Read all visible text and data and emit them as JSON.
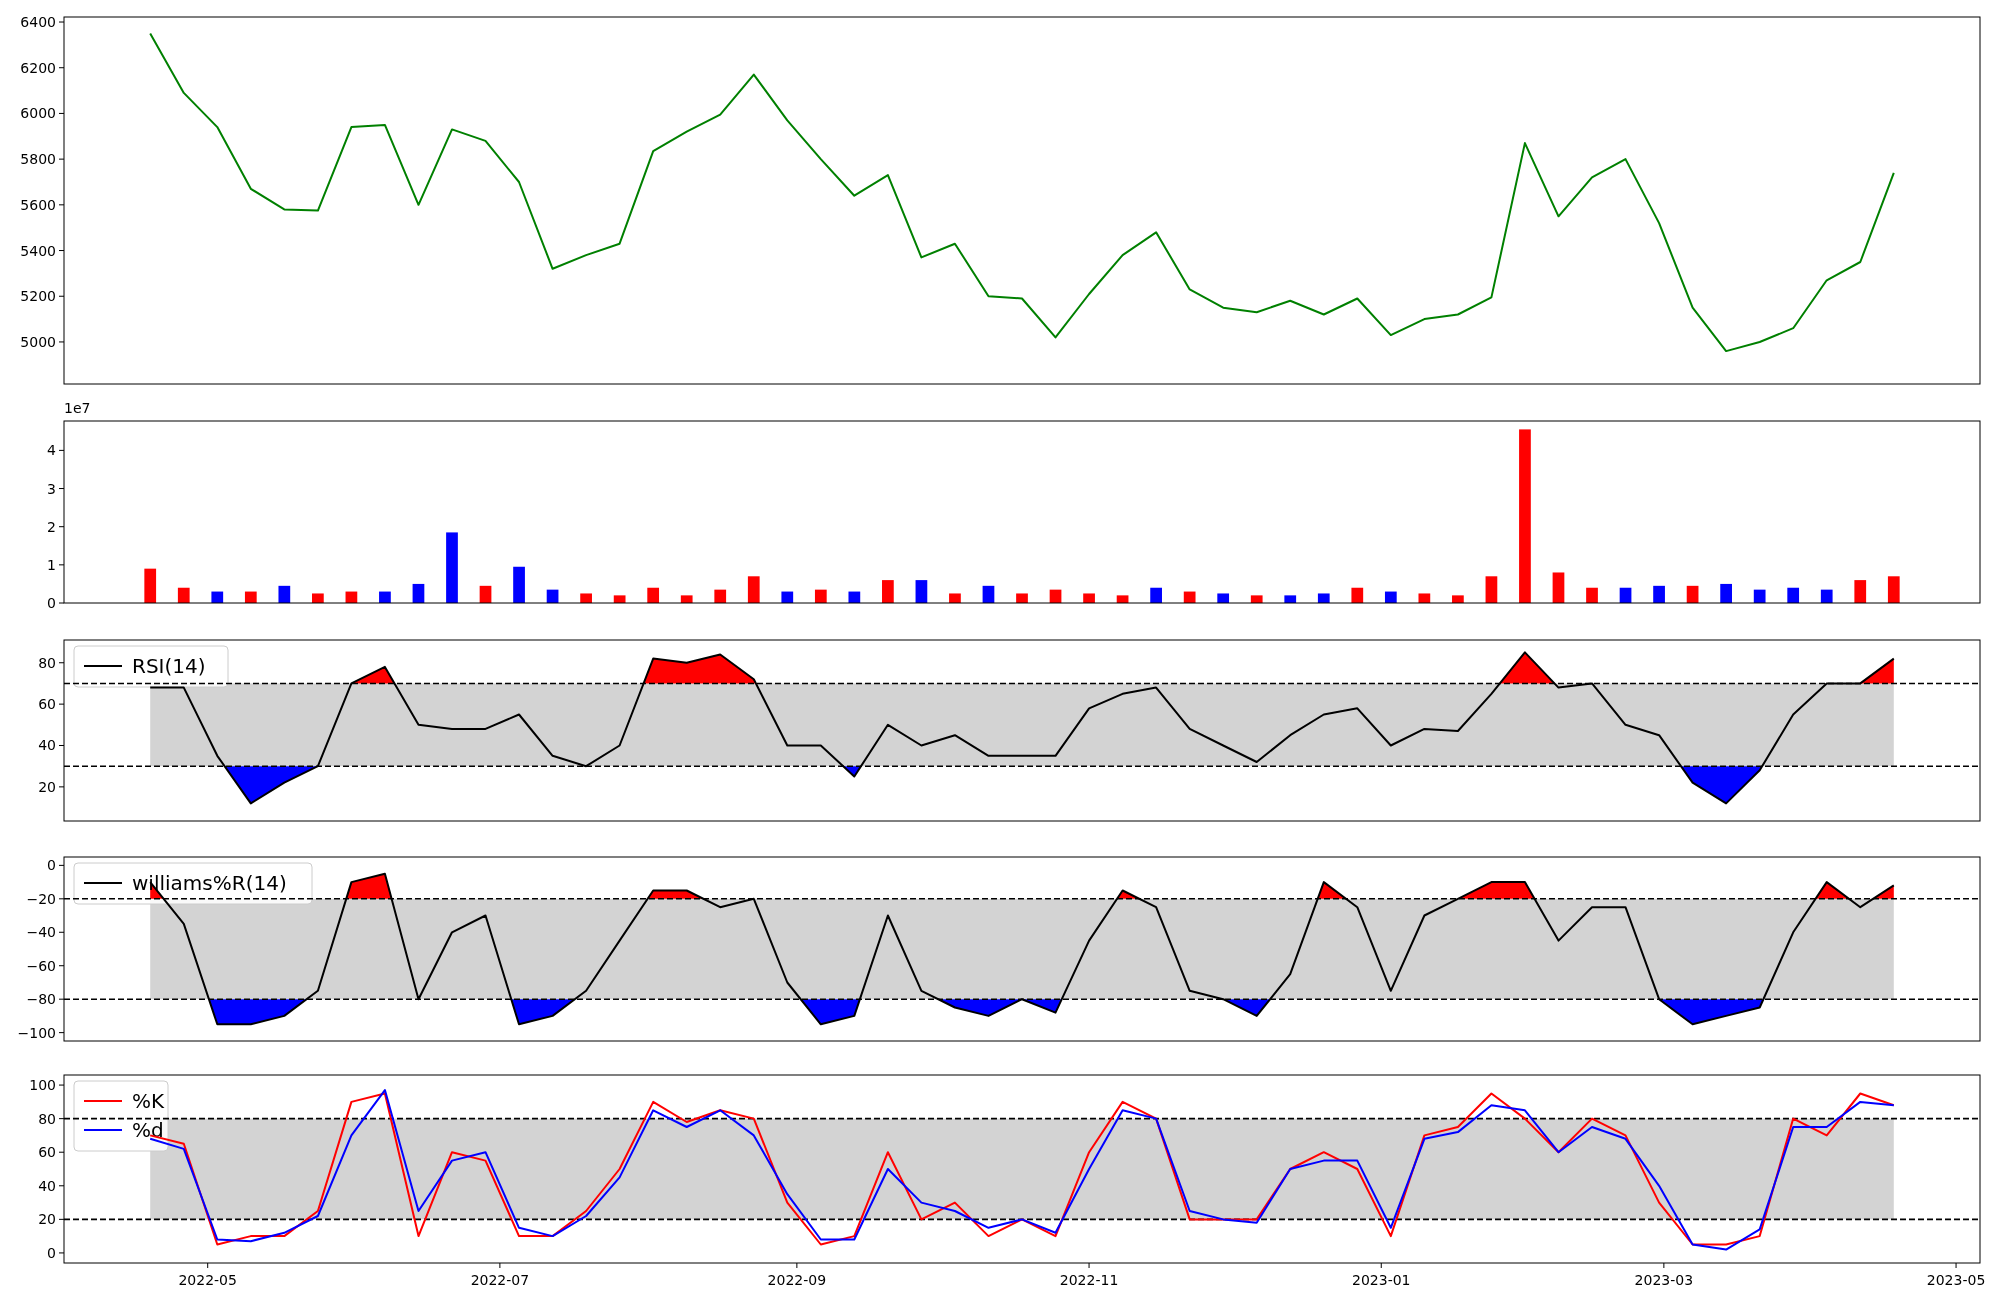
{
  "panels": [
    {
      "chart_data": {
        "type": "line",
        "x": [
          "2022-04-19",
          "2022-04-26",
          "2022-05-03",
          "2022-05-10",
          "2022-05-17",
          "2022-05-24",
          "2022-05-31",
          "2022-06-07",
          "2022-06-14",
          "2022-06-21",
          "2022-06-28",
          "2022-07-05",
          "2022-07-12",
          "2022-07-19",
          "2022-07-26",
          "2022-08-02",
          "2022-08-09",
          "2022-08-16",
          "2022-08-23",
          "2022-08-30",
          "2022-09-06",
          "2022-09-13",
          "2022-09-20",
          "2022-09-27",
          "2022-10-04",
          "2022-10-11",
          "2022-10-18",
          "2022-10-25",
          "2022-11-01",
          "2022-11-08",
          "2022-11-15",
          "2022-11-22",
          "2022-11-29",
          "2022-12-06",
          "2022-12-13",
          "2022-12-20",
          "2022-12-27",
          "2023-01-03",
          "2023-01-10",
          "2023-01-17",
          "2023-01-24",
          "2023-01-31",
          "2023-02-07",
          "2023-02-14",
          "2023-02-21",
          "2023-02-28",
          "2023-03-07",
          "2023-03-14",
          "2023-03-21",
          "2023-03-28",
          "2023-04-04",
          "2023-04-11",
          "2023-04-18"
        ],
        "series": [
          {
            "color": "#008000",
            "values": [
              6350,
              6090,
              5940,
              5670,
              5580,
              5575,
              5940,
              5950,
              5600,
              5930,
              5880,
              5700,
              5320,
              5380,
              5430,
              5835,
              5920,
              5995,
              6170,
              5970,
              5800,
              5640,
              5730,
              5370,
              5430,
              5200,
              5190,
              5020,
              5210,
              5380,
              5480,
              5230,
              5150,
              5130,
              5180,
              5120,
              5190,
              5030,
              5100,
              5120,
              5195,
              5870,
              5550,
              5720,
              5800,
              5520,
              5150,
              4960,
              5000,
              5060,
              5270,
              5350,
              5740
            ]
          }
        ],
        "xlim": [
          "2022-04-01",
          "2023-05-06"
        ],
        "ylim": [
          4816,
          6422
        ],
        "yticks": [
          5000,
          5200,
          5400,
          5600,
          5800,
          6000,
          6200,
          6400
        ]
      }
    },
    {
      "axis_multiplier": "1e7",
      "chart_data": {
        "type": "bar",
        "x": [
          "2022-04-19",
          "2022-04-26",
          "2022-05-03",
          "2022-05-10",
          "2022-05-17",
          "2022-05-24",
          "2022-05-31",
          "2022-06-07",
          "2022-06-14",
          "2022-06-21",
          "2022-06-28",
          "2022-07-05",
          "2022-07-12",
          "2022-07-19",
          "2022-07-26",
          "2022-08-02",
          "2022-08-09",
          "2022-08-16",
          "2022-08-23",
          "2022-08-30",
          "2022-09-06",
          "2022-09-13",
          "2022-09-20",
          "2022-09-27",
          "2022-10-04",
          "2022-10-11",
          "2022-10-18",
          "2022-10-25",
          "2022-11-01",
          "2022-11-08",
          "2022-11-15",
          "2022-11-22",
          "2022-11-29",
          "2022-12-06",
          "2022-12-13",
          "2022-12-20",
          "2022-12-27",
          "2023-01-03",
          "2023-01-10",
          "2023-01-17",
          "2023-01-24",
          "2023-01-31",
          "2023-02-07",
          "2023-02-14",
          "2023-02-21",
          "2023-02-28",
          "2023-03-07",
          "2023-03-14",
          "2023-03-21",
          "2023-03-28",
          "2023-04-04",
          "2023-04-11",
          "2023-04-18"
        ],
        "series": [
          {
            "color": "#ff0000",
            "values": [
              0.9,
              0.4,
              null,
              0.3,
              null,
              0.25,
              0.3,
              null,
              null,
              null,
              0.45,
              null,
              null,
              0.25,
              0.2,
              0.4,
              0.2,
              0.35,
              0.7,
              null,
              0.35,
              null,
              0.6,
              null,
              0.25,
              null,
              0.25,
              0.35,
              0.25,
              0.2,
              null,
              0.3,
              null,
              0.2,
              null,
              null,
              0.4,
              null,
              0.25,
              0.2,
              0.7,
              4.55,
              0.8,
              0.4,
              null,
              null,
              0.45,
              null,
              null,
              null,
              null,
              0.6,
              0.7
            ]
          },
          {
            "color": "#0000ff",
            "values": [
              null,
              null,
              0.3,
              null,
              0.45,
              null,
              null,
              0.3,
              0.5,
              1.85,
              null,
              0.95,
              0.35,
              null,
              null,
              null,
              null,
              null,
              null,
              0.3,
              null,
              0.3,
              null,
              0.6,
              null,
              0.45,
              null,
              null,
              null,
              null,
              0.4,
              null,
              0.25,
              null,
              0.2,
              0.25,
              null,
              0.3,
              null,
              null,
              null,
              null,
              null,
              null,
              0.4,
              0.45,
              null,
              0.5,
              0.35,
              0.4,
              0.35,
              null,
              null
            ]
          }
        ],
        "xlim": [
          "2022-04-01",
          "2023-05-06"
        ],
        "ylim": [
          0,
          4.77
        ],
        "yticks": [
          0,
          1,
          2,
          3,
          4
        ]
      }
    },
    {
      "chart_data": {
        "type": "line",
        "x": [
          "2022-04-19",
          "2022-04-26",
          "2022-05-03",
          "2022-05-10",
          "2022-05-17",
          "2022-05-24",
          "2022-05-31",
          "2022-06-07",
          "2022-06-14",
          "2022-06-21",
          "2022-06-28",
          "2022-07-05",
          "2022-07-12",
          "2022-07-19",
          "2022-07-26",
          "2022-08-02",
          "2022-08-09",
          "2022-08-16",
          "2022-08-23",
          "2022-08-30",
          "2022-09-06",
          "2022-09-13",
          "2022-09-20",
          "2022-09-27",
          "2022-10-04",
          "2022-10-11",
          "2022-10-18",
          "2022-10-25",
          "2022-11-01",
          "2022-11-08",
          "2022-11-15",
          "2022-11-22",
          "2022-11-29",
          "2022-12-06",
          "2022-12-13",
          "2022-12-20",
          "2022-12-27",
          "2023-01-03",
          "2023-01-10",
          "2023-01-17",
          "2023-01-24",
          "2023-01-31",
          "2023-02-07",
          "2023-02-14",
          "2023-02-21",
          "2023-02-28",
          "2023-03-07",
          "2023-03-14",
          "2023-03-21",
          "2023-03-28",
          "2023-04-04",
          "2023-04-11",
          "2023-04-18"
        ],
        "series": [
          {
            "name": "RSI(14)",
            "color": "#000000",
            "values": [
              68,
              68,
              35,
              12,
              22,
              30,
              70,
              78,
              50,
              48,
              48,
              55,
              35,
              30,
              40,
              82,
              80,
              84,
              72,
              40,
              40,
              25,
              50,
              40,
              45,
              35,
              35,
              35,
              58,
              65,
              68,
              48,
              40,
              32,
              45,
              55,
              58,
              40,
              48,
              47,
              65,
              85,
              68,
              70,
              50,
              45,
              22,
              12,
              28,
              55,
              70,
              70,
              82
            ]
          }
        ],
        "xlim": [
          "2022-04-01",
          "2023-05-06"
        ],
        "ylim": [
          3.5,
          91
        ],
        "yticks": [
          20,
          40,
          60,
          80
        ],
        "legend": "upper left",
        "bands": [
          {
            "axis": "y",
            "from": 30,
            "to": 70,
            "color": "#d3d3d3"
          }
        ],
        "ref_lines": [
          {
            "axis": "y",
            "value": 70
          },
          {
            "axis": "y",
            "value": 30
          }
        ]
      },
      "fills": [
        {
          "color": "#ff0000"
        },
        {
          "color": "#0000ff"
        }
      ]
    },
    {
      "chart_data": {
        "type": "line",
        "x": [
          "2022-04-19",
          "2022-04-26",
          "2022-05-03",
          "2022-05-10",
          "2022-05-17",
          "2022-05-24",
          "2022-05-31",
          "2022-06-07",
          "2022-06-14",
          "2022-06-21",
          "2022-06-28",
          "2022-07-05",
          "2022-07-12",
          "2022-07-19",
          "2022-07-26",
          "2022-08-02",
          "2022-08-09",
          "2022-08-16",
          "2022-08-23",
          "2022-08-30",
          "2022-09-06",
          "2022-09-13",
          "2022-09-20",
          "2022-09-27",
          "2022-10-04",
          "2022-10-11",
          "2022-10-18",
          "2022-10-25",
          "2022-11-01",
          "2022-11-08",
          "2022-11-15",
          "2022-11-22",
          "2022-11-29",
          "2022-12-06",
          "2022-12-13",
          "2022-12-20",
          "2022-12-27",
          "2023-01-03",
          "2023-01-10",
          "2023-01-17",
          "2023-01-24",
          "2023-01-31",
          "2023-02-07",
          "2023-02-14",
          "2023-02-21",
          "2023-02-28",
          "2023-03-07",
          "2023-03-14",
          "2023-03-21",
          "2023-03-28",
          "2023-04-04",
          "2023-04-11",
          "2023-04-18"
        ],
        "series": [
          {
            "name": "williams%R(14)",
            "color": "#000000",
            "values": [
              -10,
              -35,
              -95,
              -95,
              -90,
              -75,
              -10,
              -5,
              -80,
              -40,
              -30,
              -95,
              -90,
              -75,
              -45,
              -15,
              -15,
              -25,
              -20,
              -70,
              -95,
              -90,
              -30,
              -75,
              -85,
              -90,
              -80,
              -88,
              -45,
              -15,
              -25,
              -75,
              -80,
              -90,
              -65,
              -10,
              -25,
              -75,
              -30,
              -20,
              -10,
              -10,
              -45,
              -25,
              -25,
              -80,
              -95,
              -90,
              -85,
              -40,
              -10,
              -25,
              -12
            ]
          }
        ],
        "xlim": [
          "2022-04-01",
          "2023-05-06"
        ],
        "ylim": [
          -105,
          5
        ],
        "yticks": [
          {
            "value": 0,
            "label": "0"
          },
          {
            "value": -20,
            "label": "−20"
          },
          {
            "value": -40,
            "label": "−40"
          },
          {
            "value": -60,
            "label": "−60"
          },
          {
            "value": -80,
            "label": "−80"
          },
          {
            "value": -100,
            "label": "−100"
          }
        ],
        "legend": "upper left",
        "bands": [
          {
            "axis": "y",
            "from": -80,
            "to": -20,
            "color": "#d3d3d3"
          }
        ],
        "ref_lines": [
          {
            "axis": "y",
            "value": -20
          },
          {
            "axis": "y",
            "value": -80
          }
        ]
      },
      "fills": [
        {
          "color": "#ff0000"
        },
        {
          "color": "#0000ff"
        }
      ]
    },
    {
      "chart_data": {
        "type": "line",
        "x": [
          "2022-04-19",
          "2022-04-26",
          "2022-05-03",
          "2022-05-10",
          "2022-05-17",
          "2022-05-24",
          "2022-05-31",
          "2022-06-07",
          "2022-06-14",
          "2022-06-21",
          "2022-06-28",
          "2022-07-05",
          "2022-07-12",
          "2022-07-19",
          "2022-07-26",
          "2022-08-02",
          "2022-08-09",
          "2022-08-16",
          "2022-08-23",
          "2022-08-30",
          "2022-09-06",
          "2022-09-13",
          "2022-09-20",
          "2022-09-27",
          "2022-10-04",
          "2022-10-11",
          "2022-10-18",
          "2022-10-25",
          "2022-11-01",
          "2022-11-08",
          "2022-11-15",
          "2022-11-22",
          "2022-11-29",
          "2022-12-06",
          "2022-12-13",
          "2022-12-20",
          "2022-12-27",
          "2023-01-03",
          "2023-01-10",
          "2023-01-17",
          "2023-01-24",
          "2023-01-31",
          "2023-02-07",
          "2023-02-14",
          "2023-02-21",
          "2023-02-28",
          "2023-03-07",
          "2023-03-14",
          "2023-03-21",
          "2023-03-28",
          "2023-04-04",
          "2023-04-11",
          "2023-04-18"
        ],
        "series": [
          {
            "name": "%K",
            "color": "#ff0000",
            "values": [
              70,
              65,
              5,
              10,
              10,
              25,
              90,
              95,
              10,
              60,
              55,
              10,
              10,
              25,
              50,
              90,
              78,
              85,
              80,
              30,
              5,
              10,
              60,
              20,
              30,
              10,
              20,
              10,
              60,
              90,
              80,
              20,
              20,
              20,
              50,
              60,
              50,
              10,
              70,
              75,
              95,
              80,
              60,
              80,
              70,
              30,
              5,
              5,
              10,
              80,
              70,
              95,
              88
            ]
          },
          {
            "name": "%d",
            "color": "#0000ff",
            "values": [
              68,
              62,
              8,
              7,
              12,
              22,
              70,
              97,
              25,
              55,
              60,
              15,
              10,
              22,
              45,
              85,
              75,
              85,
              70,
              35,
              8,
              8,
              50,
              30,
              25,
              15,
              20,
              12,
              50,
              85,
              80,
              25,
              20,
              18,
              50,
              55,
              55,
              15,
              68,
              72,
              88,
              85,
              60,
              75,
              68,
              40,
              5,
              2,
              14,
              75,
              75,
              90,
              88
            ]
          }
        ],
        "xlim": [
          "2022-04-01",
          "2023-05-06"
        ],
        "ylim": [
          -6,
          106
        ],
        "yticks": [
          0,
          20,
          40,
          60,
          80,
          100
        ],
        "xticks": [
          {
            "value": "2022-05-01",
            "label": "2022-05"
          },
          {
            "value": "2022-07-01",
            "label": "2022-07"
          },
          {
            "value": "2022-09-01",
            "label": "2022-09"
          },
          {
            "value": "2022-11-01",
            "label": "2022-11"
          },
          {
            "value": "2023-01-01",
            "label": "2023-01"
          },
          {
            "value": "2023-03-01",
            "label": "2023-03"
          },
          {
            "value": "2023-05-01",
            "label": "2023-05"
          }
        ],
        "legend": "upper left",
        "bands": [
          {
            "axis": "y",
            "from": 20,
            "to": 80,
            "color": "#d3d3d3"
          }
        ],
        "ref_lines": [
          {
            "axis": "y",
            "value": 80
          },
          {
            "axis": "y",
            "value": 20
          }
        ]
      }
    }
  ]
}
